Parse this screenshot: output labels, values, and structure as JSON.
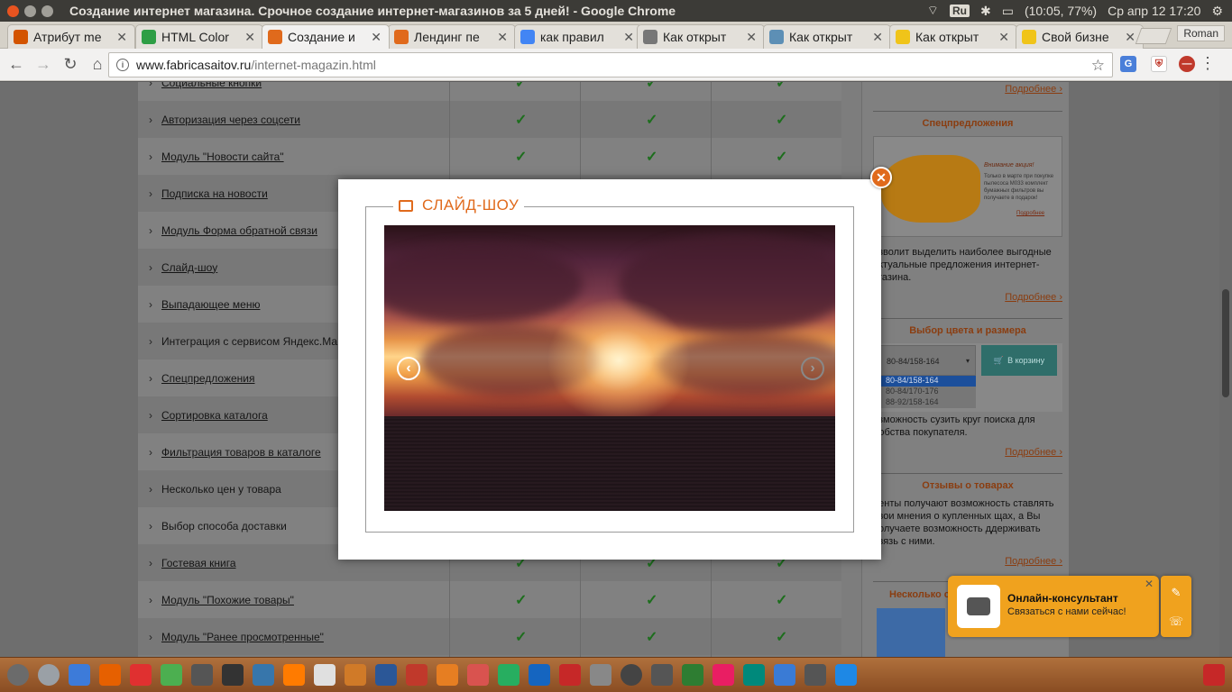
{
  "window": {
    "title": "Создание интернет магазина. Срочное создание интернет-магазинов за 5 дней! - Google Chrome",
    "tray": {
      "keyboard": "Ru",
      "battery": "(10:05, 77%)",
      "clock": "Ср апр 12 17:20"
    }
  },
  "tabs": [
    {
      "label": "Атрибут me",
      "icon": "docs-icon",
      "color": "#d35400"
    },
    {
      "label": "HTML Color",
      "icon": "color-icon",
      "color": "#2e9e45"
    },
    {
      "label": "Создание и",
      "icon": "fabrica-icon",
      "color": "#e06a1c",
      "active": true
    },
    {
      "label": "Лендинг пе",
      "icon": "fabrica-icon",
      "color": "#e06a1c"
    },
    {
      "label": "как правил",
      "icon": "google-icon",
      "color": "#4285f4"
    },
    {
      "label": "Как открыт",
      "icon": "wiki-icon",
      "color": "#777777"
    },
    {
      "label": "Как открыт",
      "icon": "h-icon",
      "color": "#5d8fb5"
    },
    {
      "label": "Как открыт",
      "icon": "yellow-circle-icon",
      "color": "#f0c419"
    },
    {
      "label": "Свой бизне",
      "icon": "yellow-circle-icon",
      "color": "#f0c419"
    }
  ],
  "profile": "Roman",
  "address": {
    "host": "www.fabricasaitov.ru",
    "path": "/internet-magazin.html"
  },
  "features": [
    {
      "label": "Социальные кнопки",
      "link": true
    },
    {
      "label": "Авторизация через соцсети",
      "link": true
    },
    {
      "label": "Модуль \"Новости сайта\"",
      "link": true
    },
    {
      "label": "Подписка на новости",
      "link": true
    },
    {
      "label": "Модуль Форма обратной связи",
      "link": true
    },
    {
      "label": "Слайд-шоу",
      "link": true
    },
    {
      "label": "Выпадающее меню",
      "link": true
    },
    {
      "label": "Интеграция с сервисом Яндекс.Ма",
      "link": false
    },
    {
      "label": "Спецпредложения",
      "link": true
    },
    {
      "label": "Сортировка каталога",
      "link": true
    },
    {
      "label": "Фильтрация товаров в каталоге",
      "link": true
    },
    {
      "label": "Несколько цен у товара",
      "link": false
    },
    {
      "label": "Выбор способа доставки",
      "link": false
    },
    {
      "label": "Гостевая книга",
      "link": true
    },
    {
      "label": "Модуль \"Похожие товары\"",
      "link": true
    },
    {
      "label": "Модуль \"Ранее просмотренные\"",
      "link": true
    }
  ],
  "sidebar": {
    "more": "Подробнее ›",
    "special": {
      "title": "Спецпредложения",
      "promo": [
        "Внимание акция!",
        "Только в марте при покупке пылесоса М033 комплект бумажных фильтров вы получаете в подарок!",
        "Подробнее"
      ],
      "text": "озволит выделить наиболее выгодные актуальные предложения интернет-агазина."
    },
    "color": {
      "title": "Выбор цвета и размера",
      "selected": "80-84/158-164",
      "options": [
        "80-84/158-164",
        "80-84/170-176",
        "88-92/158-164"
      ],
      "cart": "В корзину",
      "text": "озможность сузить круг поиска для добства покупателя."
    },
    "reviews": {
      "title": "Отзывы о товарах",
      "text": "иенты получают возможность ставлять свои мнения о купленных щах, а Вы получаете возможность ддерживать связь с ними."
    },
    "similar": {
      "title": "Несколько с"
    }
  },
  "modal": {
    "title": "СЛАЙД-ШОУ"
  },
  "consultant": {
    "title": "Онлайн-консультант",
    "subtitle": "Связаться с нами сейчас!"
  }
}
